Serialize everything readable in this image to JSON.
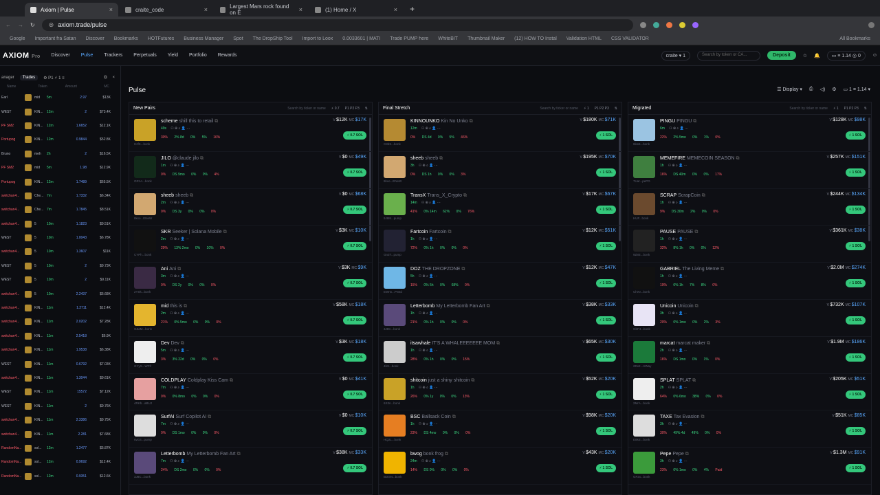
{
  "browser": {
    "tabs": [
      {
        "title": "Axiom | Pulse"
      },
      {
        "title": "craite_code"
      },
      {
        "title": "Largest Mars rock found on E"
      },
      {
        "title": "(1) Home / X"
      }
    ],
    "url": "axiom.trade/pulse",
    "bookmarks": [
      "Google",
      "Important fra Satan",
      "Discover",
      "Bookmarks",
      "HOTFutures",
      "Business Manager",
      "Spot",
      "The DropShip Tool",
      "Import to Loox",
      "0.0033601 | MATI",
      "Trade PUMP here",
      "WhiteBIT",
      "Thumbnail Maker",
      "(12) HOW TO Instal",
      "Validation HTML",
      "CSS VALIDATOR",
      "All Bookmarks"
    ]
  },
  "nav": {
    "brand": "AXIOM",
    "brand_tier": "Pro",
    "items": [
      "Discover",
      "Pulse",
      "Trackers",
      "Perpetuals",
      "Yield",
      "Portfolio",
      "Rewards"
    ],
    "wallet": "craite",
    "wallet_count": "1",
    "search_placeholder": "Search by token or CA...",
    "deposit": "Deposit",
    "sol_balance": "1.14",
    "other_balance": "0"
  },
  "left": {
    "tab_active": "Trades",
    "tab_label_left": "anager",
    "col_name": "Name",
    "col_token": "Token",
    "col_amount": "Amount",
    "col_mc": "MC",
    "trades": [
      {
        "name": "Earl",
        "token": "mid",
        "time": "5m",
        "amount": "2.97",
        "mc": "$13K"
      },
      {
        "name": "WEST",
        "token": "KIN...",
        "time": "12m",
        "amount": "2",
        "mc": "$73.4K"
      },
      {
        "name": "PF SM2",
        "token": "KIN...",
        "time": "12m",
        "amount": "1.6652",
        "mc": "$12.1K"
      },
      {
        "name": "Portupog",
        "token": "KIN...",
        "time": "12m",
        "amount": "0.9844",
        "mc": "$52.8K"
      },
      {
        "name": "Bruno",
        "token": "meh",
        "time": "2h",
        "amount": "2",
        "mc": "$16.5K"
      },
      {
        "name": "PF SM2",
        "token": "mid",
        "time": "5m",
        "amount": "1.98",
        "mc": "$12.9K"
      },
      {
        "name": "Portupog",
        "token": "KIN...",
        "time": "12m",
        "amount": "1.7489",
        "mc": "$65.5K"
      },
      {
        "name": "switchan4...",
        "token": "Che...",
        "time": "7m",
        "amount": "1.7332",
        "mc": "$6.34K"
      },
      {
        "name": "switchan4...",
        "token": "Che...",
        "time": "7m",
        "amount": "1.7845",
        "mc": "$8.51K"
      },
      {
        "name": "switchan4...",
        "token": "5",
        "time": "10m",
        "amount": "1.1823",
        "mc": "$9.51K"
      },
      {
        "name": "WEST",
        "token": "5",
        "time": "10m",
        "amount": "1.0043",
        "mc": "$6.78K"
      },
      {
        "name": "switchan4...",
        "token": "5",
        "time": "10m",
        "amount": "1.3607",
        "mc": "$11K"
      },
      {
        "name": "WEST",
        "token": "5",
        "time": "10m",
        "amount": "2",
        "mc": "$9.73K"
      },
      {
        "name": "WEST",
        "token": "5",
        "time": "10m",
        "amount": "2",
        "mc": "$9.11K"
      },
      {
        "name": "switchan4...",
        "token": "5",
        "time": "10m",
        "amount": "2.2437",
        "mc": "$6.68K"
      },
      {
        "name": "switchan4...",
        "token": "KIN...",
        "time": "11m",
        "amount": "1.2711",
        "mc": "$12.4K"
      },
      {
        "name": "switchan4...",
        "token": "KIN...",
        "time": "11m",
        "amount": "2.0202",
        "mc": "$7.28K"
      },
      {
        "name": "switchan4...",
        "token": "KIN...",
        "time": "11m",
        "amount": "2.5418",
        "mc": "$6.9K"
      },
      {
        "name": "switchan4...",
        "token": "KIN...",
        "time": "11m",
        "amount": "1.9538",
        "mc": "$6.38K"
      },
      {
        "name": "WEST",
        "token": "KIN...",
        "time": "11m",
        "amount": "0.6792",
        "mc": "$7.03K"
      },
      {
        "name": "switchan4...",
        "token": "KIN...",
        "time": "11m",
        "amount": "1.3044",
        "mc": "$9.61K"
      },
      {
        "name": "WEST",
        "token": "KIN...",
        "time": "11m",
        "amount": "15572",
        "mc": "$7.12K"
      },
      {
        "name": "WEST",
        "token": "KIN...",
        "time": "11m",
        "amount": "2",
        "mc": "$9.76K"
      },
      {
        "name": "switchan4...",
        "token": "KIN...",
        "time": "11m",
        "amount": "2.3386",
        "mc": "$9.75K"
      },
      {
        "name": "switchan4...",
        "token": "KIN...",
        "time": "11m",
        "amount": "2.281",
        "mc": "$7.68K"
      },
      {
        "name": "RandomNa...",
        "token": "sol...",
        "time": "12m",
        "amount": "1.2477",
        "mc": "$5.87K"
      },
      {
        "name": "RandomNa...",
        "token": "sol...",
        "time": "12m",
        "amount": "0.9692",
        "mc": "$12.4K"
      },
      {
        "name": "RandomNa...",
        "token": "sol...",
        "time": "12m",
        "amount": "0.9351",
        "mc": "$12.6K"
      }
    ]
  },
  "pulse": {
    "title": "Pulse",
    "display": "Display",
    "balance": "1.14"
  },
  "columns": [
    {
      "title": "New Pairs",
      "search": "Search by ticker or name",
      "count": "0.7",
      "cards": [
        {
          "tick": "scheme",
          "name": "shill this to retail",
          "age": "49s",
          "addr": "HzfK...bonk",
          "v": "$12K",
          "mc": "$17K",
          "img": "#c9a227",
          "buy": "0.7 SOL",
          "p": [
            "30%",
            "2% 8d",
            "0%",
            "5%",
            "16%"
          ]
        },
        {
          "tick": "JILO",
          "name": "@claude jilo",
          "age": "1m",
          "addr": "GR1A...bonk",
          "v": "$0",
          "mc": "$49K",
          "img": "#122a1a",
          "buy": "0.7 SOL",
          "p": [
            "0%",
            "DS 9mo",
            "0%",
            "0%",
            "4%"
          ]
        },
        {
          "tick": "sheeb",
          "name": "sheeb",
          "age": "2m",
          "addr": "8kxo...ENeW",
          "v": "$0",
          "mc": "$68K",
          "img": "#d2a871",
          "buy": "0.7 SOL",
          "p": [
            "0%",
            "DS 3y",
            "0%",
            "0%",
            "0%"
          ]
        },
        {
          "tick": "SKR",
          "name": "Seeker | Solana Mobile",
          "age": "2m",
          "addr": "CYPh...bonk",
          "v": "$3K",
          "mc": "$10K",
          "img": "#111",
          "buy": "0.7 SOL",
          "p": [
            "29%",
            "13% 2mo",
            "0%",
            "10%",
            "0%"
          ]
        },
        {
          "tick": "Ani",
          "name": "Ani",
          "age": "3m",
          "addr": "2YSk...bonk",
          "v": "$3K",
          "mc": "$9K",
          "img": "#3a2a44",
          "buy": "0.7 SOL",
          "p": [
            "0%",
            "DS 2y",
            "0%",
            "0%",
            "0%"
          ]
        },
        {
          "tick": "mid",
          "name": "this is",
          "age": "2m",
          "addr": "GZaM...bonk",
          "v": "$58K",
          "mc": "$18K",
          "img": "#e4b52e",
          "buy": "0.7 SOL",
          "p": [
            "21%",
            "0% 5mo",
            "0%",
            "0%",
            "0%"
          ]
        },
        {
          "tick": "Dev",
          "name": "Dev",
          "age": "5m",
          "addr": "GYyX...WFfr",
          "v": "$3K",
          "mc": "$18K",
          "img": "#eee",
          "buy": "0.7 SOL",
          "p": [
            "3%",
            "3% 22d",
            "0%",
            "0%",
            "0%"
          ]
        },
        {
          "tick": "COLDPLAY",
          "name": "Coldplay Kiss Cam",
          "age": "7m",
          "addr": "4RKb...aBUJ",
          "v": "$0",
          "mc": "$41K",
          "img": "#e6a0a0",
          "buy": "0.7 SOL",
          "p": [
            "0%",
            "0% 8mo",
            "0%",
            "0%",
            "0%"
          ]
        },
        {
          "tick": "SurfAI",
          "name": "Surf Copilot AI",
          "age": "7m",
          "addr": "6vG4...pump",
          "v": "$0",
          "mc": "$10K",
          "img": "#ddd",
          "buy": "0.7 SOL",
          "p": [
            "0%",
            "DS 1mo",
            "0%",
            "0%",
            "0%"
          ]
        },
        {
          "tick": "Letterbomb",
          "name": "My Letterbomb Fan Art",
          "age": "7m",
          "addr": "3J8C...bonk",
          "v": "$38K",
          "mc": "$33K",
          "img": "#5a4a7a",
          "buy": "0.7 SOL",
          "p": [
            "24%",
            "DS 2mo",
            "0%",
            "0%",
            "0%"
          ]
        }
      ]
    },
    {
      "title": "Final Stretch",
      "search": "Search by ticker or name",
      "count": "1",
      "cards": [
        {
          "tick": "KINNOUNKO",
          "name": "Kin No Unko",
          "age": "12m",
          "addr": "C8bS...bonk",
          "v": "$180K",
          "mc": "$71K",
          "img": "#b58a32",
          "buy": "1 SOL",
          "p": [
            "0%",
            "DS 4d",
            "0%",
            "5%",
            "46%"
          ]
        },
        {
          "tick": "sheeb",
          "name": "sheeb",
          "age": "3h",
          "addr": "8kxo...ENeW",
          "v": "$195K",
          "mc": "$70K",
          "img": "#d2a871",
          "buy": "1 SOL",
          "p": [
            "0%",
            "DS 1h",
            "0%",
            "0%",
            "3%"
          ]
        },
        {
          "tick": "TransX",
          "name": "Trans_X_Crypto",
          "age": "14m",
          "addr": "9J8M...pump",
          "v": "$17K",
          "mc": "$67K",
          "img": "#6ab04c",
          "buy": "1 SOL",
          "p": [
            "41%",
            "0% 14m",
            "62%",
            "0%",
            "76%"
          ]
        },
        {
          "tick": "Fartcoin",
          "name": "Fartcoin",
          "age": "1h",
          "addr": "Gn3T...pump",
          "v": "$12K",
          "mc": "$51K",
          "img": "#223",
          "buy": "1 SOL",
          "p": [
            "72%",
            "0% 1h",
            "0%",
            "0%",
            "0%"
          ]
        },
        {
          "tick": "DOZ",
          "name": "THE DROPZONE",
          "age": "5h",
          "addr": "EWrG...PnEd",
          "v": "$12K",
          "mc": "$47K",
          "img": "#6fb7e6",
          "buy": "1 SOL",
          "p": [
            "15%",
            "0% 5h",
            "0%",
            "68%",
            "0%"
          ]
        },
        {
          "tick": "Letterbomb",
          "name": "My Letterbomb Fan Art",
          "age": "1h",
          "addr": "3J8C...bonk",
          "v": "$38K",
          "mc": "$33K",
          "img": "#5a4a7a",
          "buy": "1 SOL",
          "p": [
            "21%",
            "0% 1h",
            "0%",
            "0%",
            "0%"
          ]
        },
        {
          "tick": "itsawhale",
          "name": "IT'S A WHALEEEEEEE MOM",
          "age": "1h",
          "addr": "4bS...bonk",
          "v": "$65K",
          "mc": "$30K",
          "img": "#ccc",
          "buy": "1 SOL",
          "p": [
            "28%",
            "0% 1h",
            "0%",
            "0%",
            "15%"
          ]
        },
        {
          "tick": "shitcoin",
          "name": "just a shiny shitcoin",
          "age": "1h",
          "addr": "6S3n...bonk",
          "v": "$52K",
          "mc": "$20K",
          "img": "#c9a227",
          "buy": "1 SOL",
          "p": [
            "26%",
            "0% 1y",
            "0%",
            "0%",
            "13%"
          ]
        },
        {
          "tick": "BSC",
          "name": "Ballsack Coin",
          "age": "1h",
          "addr": "HQ2L...bonk",
          "v": "$98K",
          "mc": "$20K",
          "img": "#e67e22",
          "buy": "1 SOL",
          "p": [
            "23%",
            "DS 4mo",
            "0%",
            "0%",
            "0%"
          ]
        },
        {
          "tick": "bwog",
          "name": "bonk frog",
          "age": "24m",
          "addr": "BDGN...bonk",
          "v": "$43K",
          "mc": "$20K",
          "img": "#f0b400",
          "buy": "1 SOL",
          "p": [
            "14%",
            "DS 0%",
            "0%",
            "0%",
            "0%"
          ]
        }
      ]
    },
    {
      "title": "Migrated",
      "search": "Search by ticker or name",
      "count": "1",
      "cards": [
        {
          "tick": "PINGU",
          "name": "PINGU",
          "age": "6m",
          "addr": "6kw6...bonk",
          "v": "$128K",
          "mc": "$98K",
          "img": "#9bc4e2",
          "buy": "1 SOL",
          "p": [
            "22%",
            "2% 5mo",
            "0%",
            "1%",
            "0%"
          ]
        },
        {
          "tick": "MEMEFIRE",
          "name": "MEMECOIN SEASON",
          "age": "1h",
          "addr": "7Uar...pePG",
          "v": "$257K",
          "mc": "$151K",
          "img": "#3f7f3f",
          "buy": "1 SOL",
          "p": [
            "16%",
            "DS 40m",
            "0%",
            "0%",
            "17%"
          ]
        },
        {
          "tick": "SCRAP",
          "name": "ScrapCoin",
          "age": "1h",
          "addr": "HUF...bonk",
          "v": "$244K",
          "mc": "$134K",
          "img": "#6b4a2e",
          "buy": "1 SOL",
          "p": [
            "9%",
            "DS 30m",
            "2%",
            "0%",
            "0%"
          ]
        },
        {
          "tick": "PAUSE",
          "name": "PAUSE",
          "age": "1h",
          "addr": "9Z8E...bonk",
          "v": "$361K",
          "mc": "$38K",
          "img": "#222",
          "buy": "1 SOL",
          "p": [
            "32%",
            "8% 1h",
            "0%",
            "0%",
            "12%"
          ]
        },
        {
          "tick": "GABRIEL",
          "name": "The Living Meme",
          "age": "1h",
          "addr": "ChXv...bonk",
          "v": "$2.0M",
          "mc": "$274K",
          "img": "#111",
          "buy": "1 SOL",
          "p": [
            "19%",
            "0% 1h",
            "7%",
            "8%",
            "0%"
          ]
        },
        {
          "tick": "Unicoin",
          "name": "Unicoin",
          "age": "3h",
          "addr": "GbF4...bonk",
          "v": "$732K",
          "mc": "$107K",
          "img": "#e8e4f5",
          "buy": "1 SOL",
          "p": [
            "20%",
            "0% 1mo",
            "0%",
            "2%",
            "3%"
          ]
        },
        {
          "tick": "marcat",
          "name": "marcat maker",
          "age": "2h",
          "addr": "2Dx2...HWay",
          "v": "$1.9M",
          "mc": "$186K",
          "img": "#1b7a3a",
          "buy": "1 SOL",
          "p": [
            "16%",
            "DS 1mo",
            "0%",
            "1%",
            "0%"
          ]
        },
        {
          "tick": "SPLAT",
          "name": "SPLAT",
          "age": "2h",
          "addr": "2MrA...bonk",
          "v": "$205K",
          "mc": "$51K",
          "img": "#eee",
          "buy": "1 SOL",
          "p": [
            "64%",
            "0% 6mo",
            "38%",
            "0%",
            "0%"
          ]
        },
        {
          "tick": "TAXE",
          "name": "Tax Evasion",
          "age": "3h",
          "addr": "E8kE...bonk",
          "v": "$51K",
          "mc": "$85K",
          "img": "#ddd",
          "buy": "1 SOL",
          "p": [
            "30%",
            "49% 4d",
            "49%",
            "0%",
            "0%"
          ]
        },
        {
          "tick": "Pepe",
          "name": "Pepe",
          "age": "3h",
          "addr": "GF2x...bonk",
          "v": "$1.3M",
          "mc": "$91K",
          "img": "#3b9b3b",
          "buy": "1 SOL",
          "p": [
            "23%",
            "0% 1mo",
            "0%",
            "4%",
            "Paid"
          ]
        }
      ]
    }
  ]
}
